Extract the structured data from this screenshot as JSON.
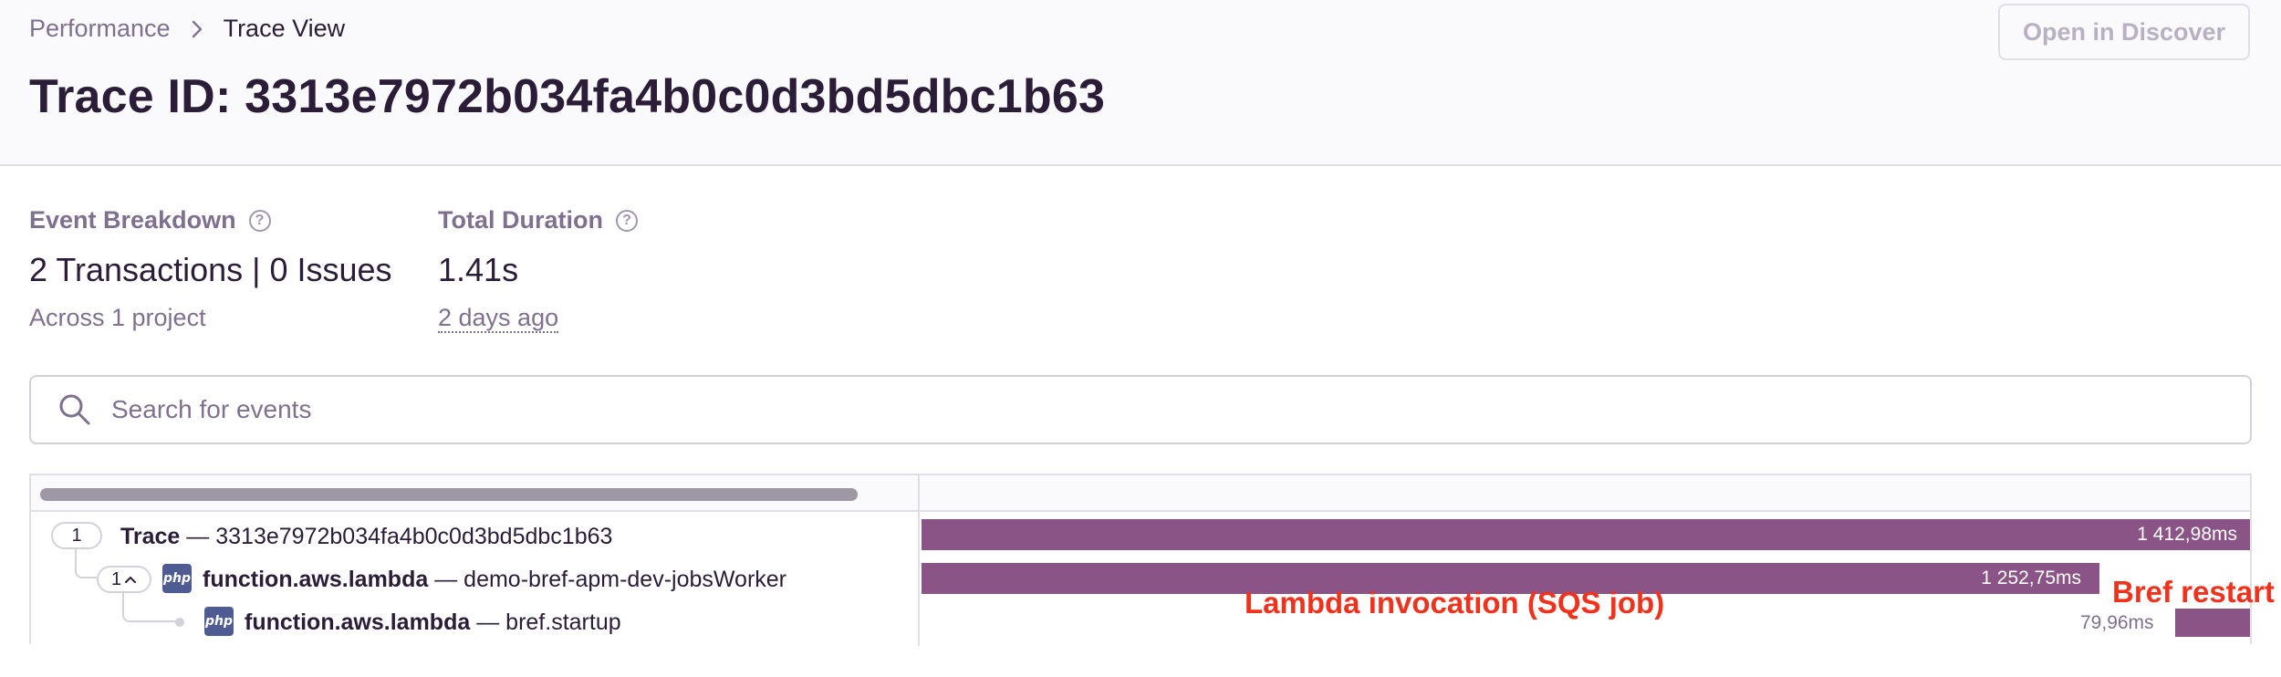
{
  "breadcrumb": {
    "parent": "Performance",
    "current": "Trace View"
  },
  "page_title": "Trace ID: 3313e7972b034fa4b0c0d3bd5dbc1b63",
  "header_button": "Open in Discover",
  "stats": {
    "event_breakdown": {
      "label": "Event Breakdown",
      "value": "2 Transactions | 0 Issues",
      "sub": "Across 1 project"
    },
    "total_duration": {
      "label": "Total Duration",
      "value": "1.41s",
      "sub": "2 days ago"
    }
  },
  "search": {
    "placeholder": "Search for events"
  },
  "trace_rows": [
    {
      "count": "1",
      "op": "Trace",
      "sep": " — ",
      "desc": "3313e7972b034fa4b0c0d3bd5dbc1b63",
      "duration": "1 412,98ms",
      "fraction": 1.0,
      "icon": ""
    },
    {
      "count": "1",
      "op": "function.aws.lambda",
      "sep": " — ",
      "desc": "demo-bref-apm-dev-jobsWorker",
      "duration": "1 252,75ms",
      "fraction": 0.8866,
      "icon": "php-icon"
    },
    {
      "op": "function.aws.lambda",
      "sep": " — ",
      "desc": "bref.startup",
      "duration": "79,96ms",
      "fraction": 0.0566,
      "icon": "php-icon"
    }
  ],
  "annotations": {
    "invocation": "Lambda invocation (SQS job)",
    "restart": "Bref restart"
  },
  "colors": {
    "bar": "#8b5487",
    "annotation": "#f0321c",
    "php": "#4f5b93"
  }
}
